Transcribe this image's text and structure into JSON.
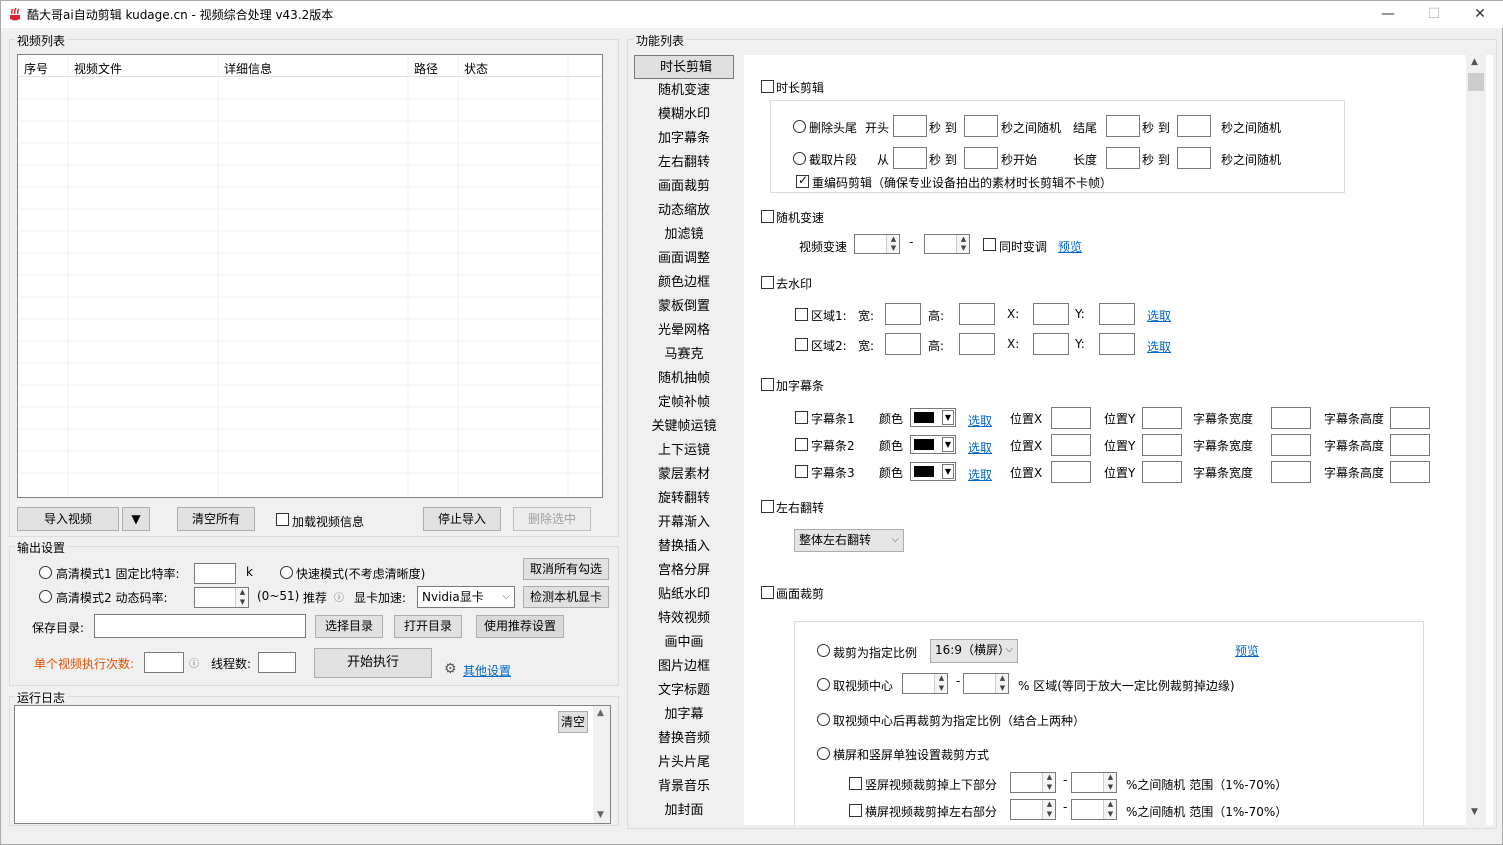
{
  "window": {
    "title": "酷大哥ai自动剪辑 kudage.cn -  视频综合处理  v43.2版本",
    "minimize": "—",
    "maximize": "☐",
    "close": "✕"
  },
  "video_list": {
    "group_title": "视频列表",
    "columns": [
      "序号",
      "视频文件",
      "详细信息",
      "路径",
      "状态"
    ],
    "import_btn": "导入视频",
    "clear_btn": "清空所有",
    "load_info_label": "加载视频信息",
    "stop_import_btn": "停止导入",
    "delete_selected_btn": "删除选中"
  },
  "output": {
    "group_title": "输出设置",
    "hd1_label": "高清模式1 固定比特率:",
    "hd1_unit": "k",
    "fast_label": "快速模式(不考虑清晰度)",
    "uncheck_all_btn": "取消所有勾选",
    "hd2_label": "高清模式2 动态码率:",
    "hd2_range": "(0~51)",
    "hd2_recommend": "推荐",
    "gpu_label": "显卡加速:",
    "gpu_value": "Nvidia显卡",
    "detect_gpu_btn": "检测本机显卡",
    "save_dir_label": "保存目录:",
    "choose_dir_btn": "选择目录",
    "open_dir_btn": "打开目录",
    "use_recommended_btn": "使用推荐设置",
    "exec_count_label": "单个视频执行次数:",
    "threads_label": "线程数:",
    "start_btn": "开始执行",
    "other_settings_link": "其他设置"
  },
  "log": {
    "group_title": "运行日志",
    "clear_btn": "清空"
  },
  "features": {
    "group_title": "功能列表",
    "tabs": [
      "时长剪辑",
      "随机变速",
      "模糊水印",
      "加字幕条",
      "左右翻转",
      "画面裁剪",
      "动态缩放",
      "加滤镜",
      "画面调整",
      "颜色边框",
      "蒙板倒置",
      "光晕网格",
      "马赛克",
      "随机抽帧",
      "定帧补帧",
      "关键帧运镜",
      "上下运镜",
      "蒙层素材",
      "旋转翻转",
      "开幕渐入",
      "替换插入",
      "宫格分屏",
      "贴纸水印",
      "特效视频",
      "画中画",
      "图片边框",
      "文字标题",
      "加字幕",
      "替换音频",
      "片头片尾",
      "背景音乐",
      "加封面"
    ]
  },
  "trim": {
    "title": "时长剪辑",
    "row1": {
      "opt": "删除头尾",
      "start": "开头",
      "sec_to": "秒 到",
      "random": "秒之间随机",
      "end": "结尾",
      "sec_to2": "秒 到",
      "random2": "秒之间随机"
    },
    "row2": {
      "opt": "截取片段",
      "from": "从",
      "sec_to": "秒 到",
      "sec_start": "秒开始",
      "length": "长度",
      "sec_to2": "秒 到",
      "random": "秒之间随机"
    },
    "reencode": "重编码剪辑（确保专业设备拍出的素材时长剪辑不卡帧）"
  },
  "speed": {
    "title": "随机变速",
    "label": "视频变速",
    "dash": "-",
    "sync_pitch": "同时变调",
    "preview": "预览"
  },
  "watermark": {
    "title": "去水印",
    "regions": [
      {
        "label": "区域1:",
        "w": "宽:",
        "h": "高:",
        "x": "X:",
        "y": "Y:",
        "pick": "选取"
      },
      {
        "label": "区域2:",
        "w": "宽:",
        "h": "高:",
        "x": "X:",
        "y": "Y:",
        "pick": "选取"
      }
    ]
  },
  "subtitle_bar": {
    "title": "加字幕条",
    "bars": [
      {
        "label": "字幕条1",
        "color": "颜色",
        "pick": "选取",
        "px": "位置X",
        "py": "位置Y",
        "width": "字幕条宽度",
        "height": "字幕条高度"
      },
      {
        "label": "字幕条2",
        "color": "颜色",
        "pick": "选取",
        "px": "位置X",
        "py": "位置Y",
        "width": "字幕条宽度",
        "height": "字幕条高度"
      },
      {
        "label": "字幕条3",
        "color": "颜色",
        "pick": "选取",
        "px": "位置X",
        "py": "位置Y",
        "width": "字幕条宽度",
        "height": "字幕条高度"
      }
    ],
    "swatch_color": "#000000"
  },
  "flip": {
    "title": "左右翻转",
    "mode": "整体左右翻转"
  },
  "crop": {
    "title": "画面裁剪",
    "opt1": "裁剪为指定比例",
    "ratio": "16:9（横屏）",
    "preview": "预览",
    "opt2": "取视频中心",
    "opt2_dash": "-",
    "opt2_suffix": "% 区域(等同于放大一定比例裁剪掉边缘)",
    "opt3": "取视频中心后再裁剪为指定比例（结合上两种）",
    "opt4": "横屏和竖屏单独设置裁剪方式",
    "sub1": "竖屏视频裁剪掉上下部分",
    "sub1_dash": "-",
    "sub1_suffix": "%之间随机 范围（1%-70%）",
    "sub2": "横屏视频裁剪掉左右部分",
    "sub2_dash": "-",
    "sub2_suffix": "%之间随机 范围（1%-70%）"
  },
  "colors": {
    "link": "#0066cc",
    "warn_label": "#e05000",
    "titlebar_bg": "#ffffff",
    "app_bg": "#f0f0f0"
  }
}
